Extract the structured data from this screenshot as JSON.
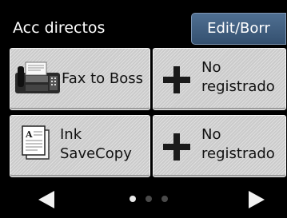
{
  "header": {
    "title": "Acc directos",
    "edit_label": "Edit/Borr"
  },
  "shortcuts": [
    {
      "icon": "fax-machine-icon",
      "label": "Fax to Boss"
    },
    {
      "icon": "plus-icon",
      "label_line1": "No",
      "label_line2": "registrado"
    },
    {
      "icon": "document-icon",
      "label_line1": "Ink",
      "label_line2": "SaveCopy"
    },
    {
      "icon": "plus-icon",
      "label_line1": "No",
      "label_line2": "registrado"
    }
  ],
  "pagination": {
    "current_page": 1,
    "total_pages": 3,
    "prev": "left-arrow-icon",
    "next": "right-arrow-icon"
  },
  "colors": {
    "background": "#000000",
    "tile": "#d6d6d6",
    "accent_button": "#3f5d80",
    "text_light": "#ffffff",
    "text_dark": "#111111"
  }
}
